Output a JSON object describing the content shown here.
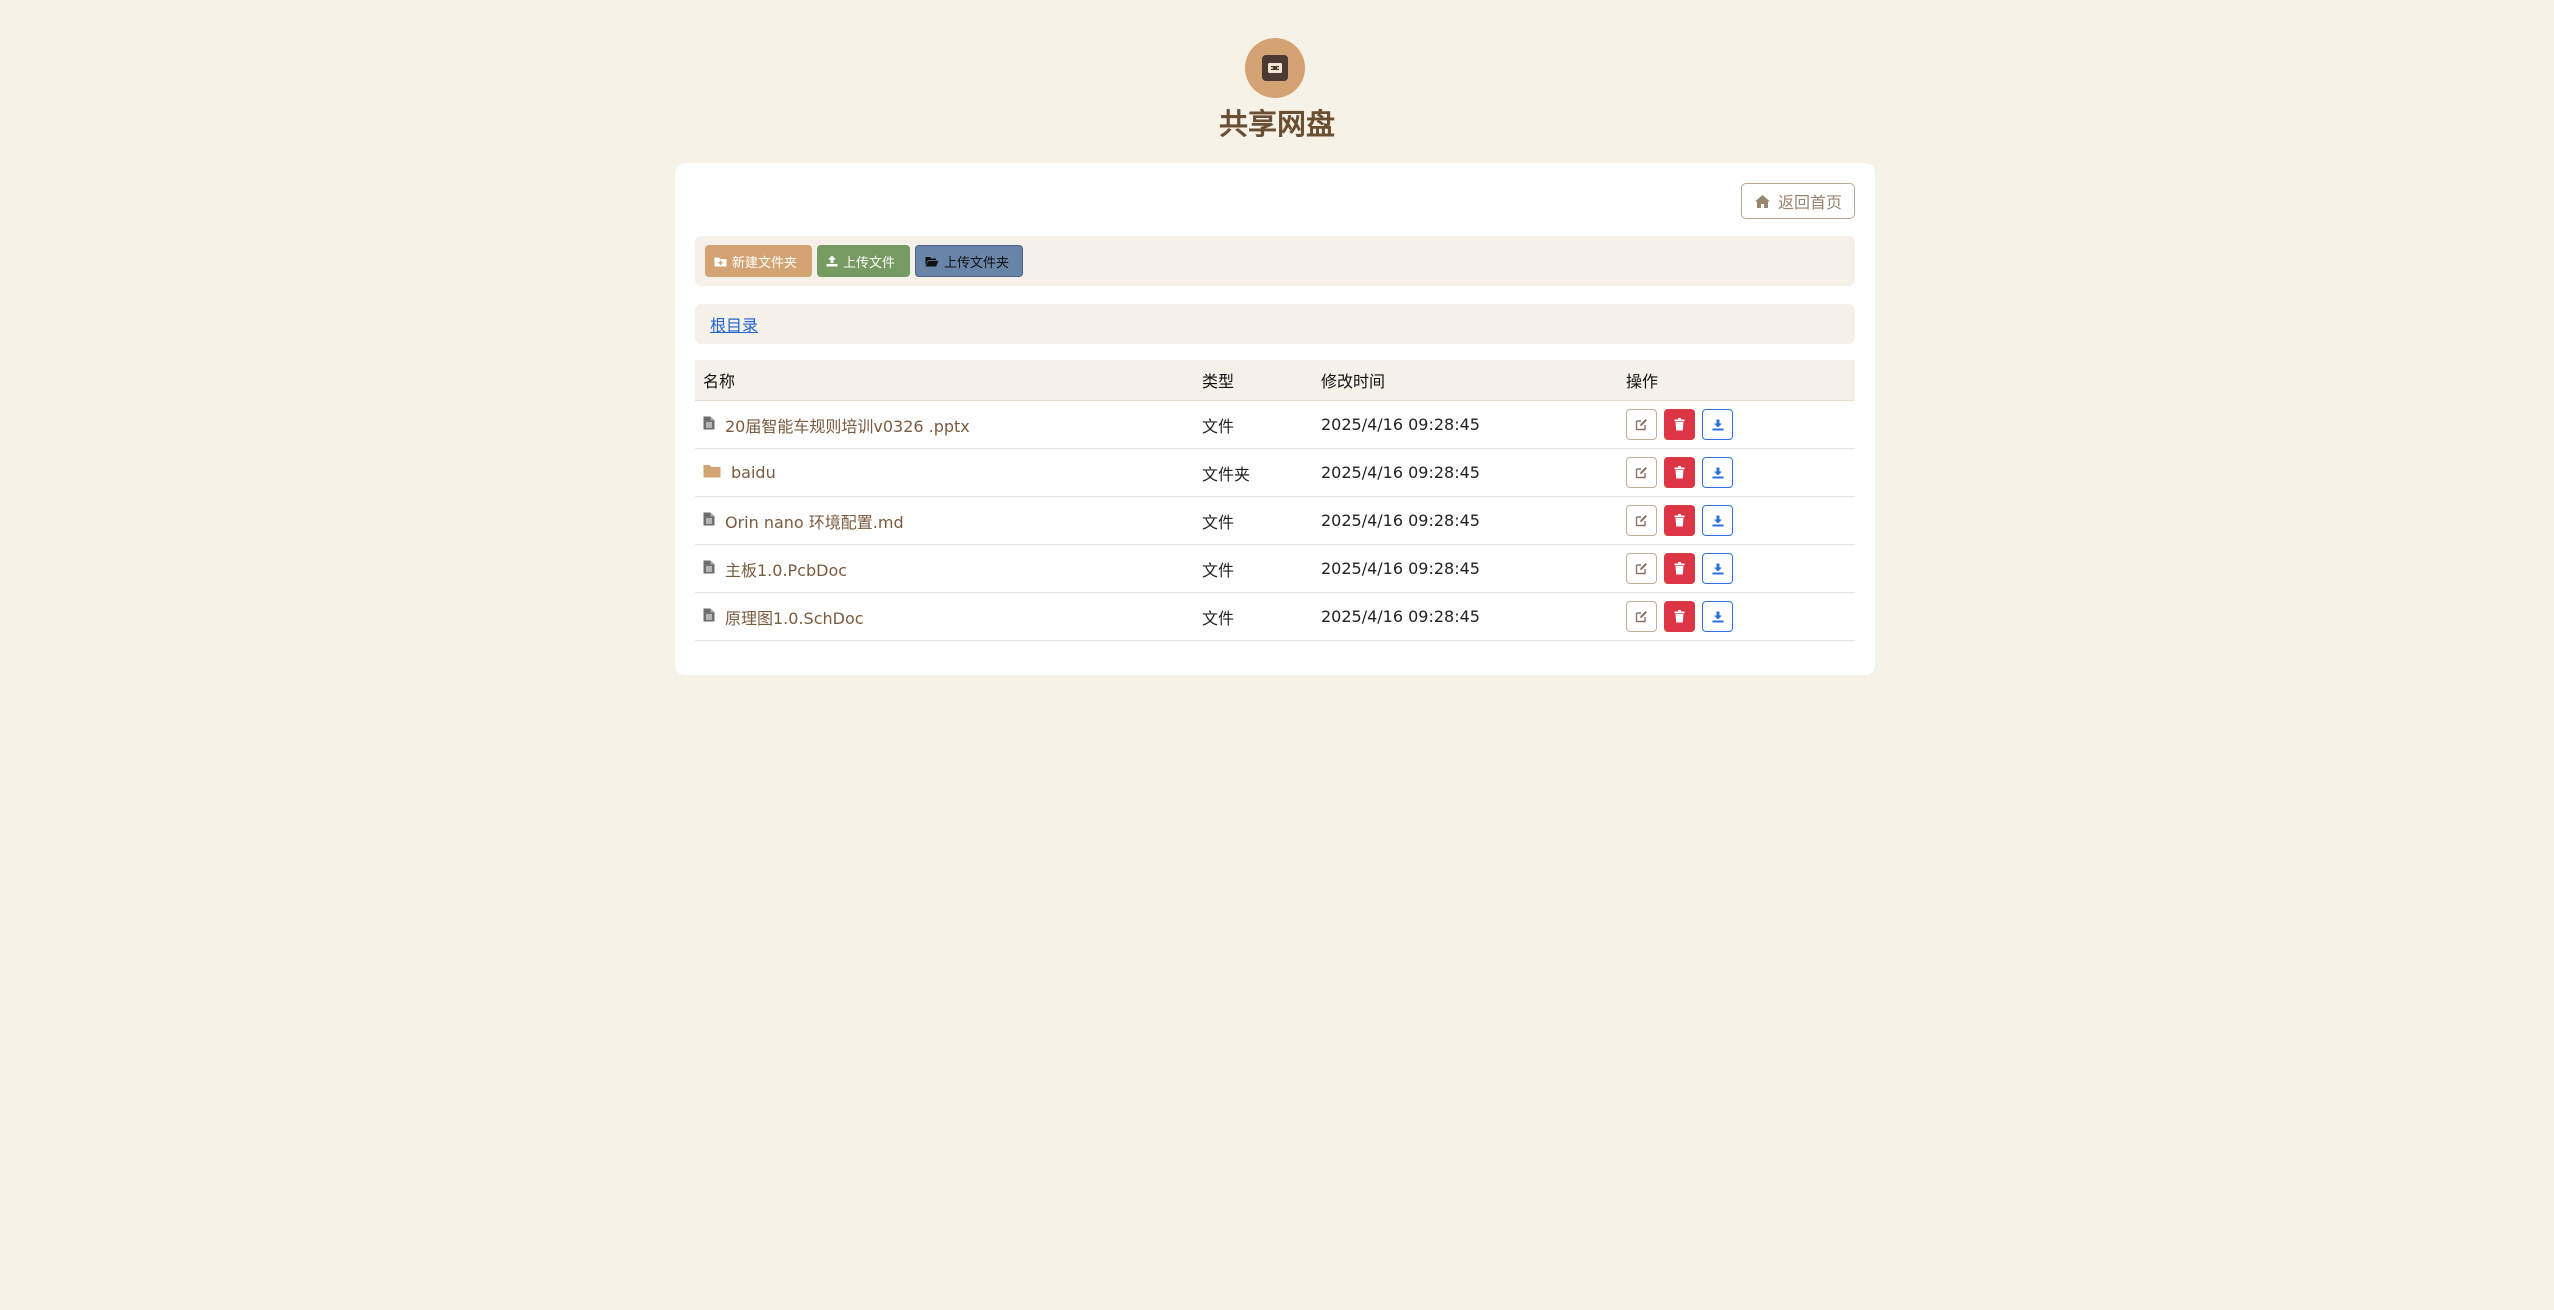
{
  "header": {
    "title": "共享网盘"
  },
  "toolbar": {
    "home_label": "返回首页",
    "new_folder_label": "新建文件夹",
    "upload_file_label": "上传文件",
    "upload_folder_label": "上传文件夹"
  },
  "breadcrumb": {
    "root": "根目录"
  },
  "table": {
    "columns": [
      "名称",
      "类型",
      "修改时间",
      "操作"
    ],
    "rows": [
      {
        "name": "20届智能车规则培训v0326 .pptx",
        "type": "文件",
        "modified": "2025/4/16 09:28:45",
        "icon": "file-icon"
      },
      {
        "name": "baidu",
        "type": "文件夹",
        "modified": "2025/4/16 09:28:45",
        "icon": "folder-icon"
      },
      {
        "name": "Orin nano 环境配置.md",
        "type": "文件",
        "modified": "2025/4/16 09:28:45",
        "icon": "file-icon"
      },
      {
        "name": "主板1.0.PcbDoc",
        "type": "文件",
        "modified": "2025/4/16 09:28:45",
        "icon": "file-icon"
      },
      {
        "name": "原理图1.0.SchDoc",
        "type": "文件",
        "modified": "2025/4/16 09:28:45",
        "icon": "file-icon"
      }
    ]
  },
  "colors": {
    "background": "#f7f2e8",
    "accent": "#d4a373",
    "title": "#6b4f33",
    "danger": "#dc3545",
    "primary": "#2f6fdd"
  }
}
